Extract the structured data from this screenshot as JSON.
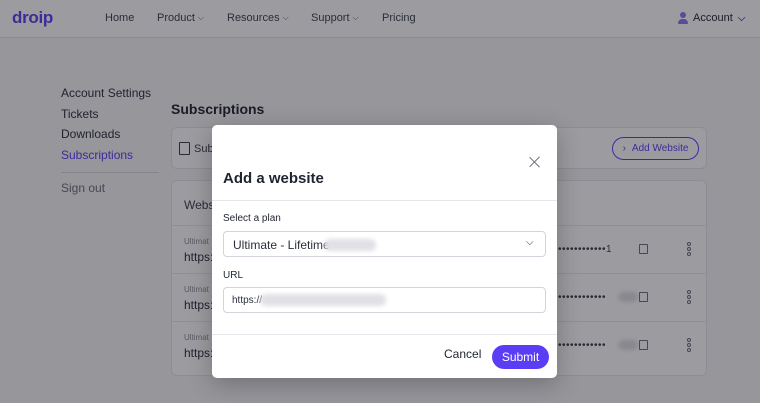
{
  "nav": {
    "logo": "droip",
    "links": [
      {
        "label": "Home",
        "has_dropdown": false
      },
      {
        "label": "Product",
        "has_dropdown": true
      },
      {
        "label": "Resources",
        "has_dropdown": true
      },
      {
        "label": "Support",
        "has_dropdown": true
      },
      {
        "label": "Pricing",
        "has_dropdown": false
      }
    ],
    "account_label": "Account"
  },
  "sidebar": {
    "items": [
      {
        "label": "Account Settings"
      },
      {
        "label": "Tickets"
      },
      {
        "label": "Downloads"
      },
      {
        "label": "Subscriptions",
        "active": true
      }
    ],
    "signout": "Sign out"
  },
  "page": {
    "heading": "Subscriptions",
    "sub_card_label": "Sub",
    "add_website_label": "Add Website",
    "websites_label": "Webs",
    "rows": [
      {
        "plan": "Ultimat",
        "url": "https:",
        "key": "••••••••••••1"
      },
      {
        "plan": "Ultimat",
        "url": "https:",
        "key": "••••••••••••"
      },
      {
        "plan": "Ultimat",
        "url": "https:",
        "key": "••••••••••••"
      }
    ]
  },
  "modal": {
    "title": "Add a website",
    "plan_label": "Select a plan",
    "plan_value": "Ultimate - Lifetime",
    "url_label": "URL",
    "url_value": "https://",
    "cancel_label": "Cancel",
    "submit_label": "Submit"
  },
  "colors": {
    "brand": "#5b3df5"
  },
  "icons": {
    "close": "close-icon",
    "chevron": "chevron-down-icon",
    "user": "user-icon",
    "document": "document-icon",
    "copy": "copy-icon",
    "more": "more-vertical-icon"
  }
}
